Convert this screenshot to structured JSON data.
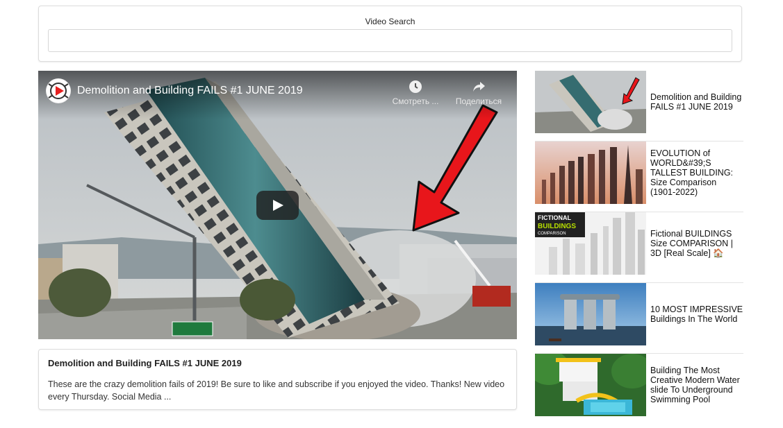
{
  "search": {
    "label": "Video Search",
    "value": "",
    "placeholder": ""
  },
  "player": {
    "title": "Demolition and Building FAILS #1 JUNE 2019",
    "watch_later_label": "Смотреть ...",
    "share_label": "Поделиться",
    "icons": [
      "channel-avatar",
      "clock-icon",
      "share-icon",
      "play-icon"
    ]
  },
  "description": {
    "title": "Demolition and Building FAILS #1 JUNE 2019",
    "text": "These are the crazy demolition fails of 2019! Be sure to like and subscribe if you enjoyed the video. Thanks! New video every Thursday. Social Media ..."
  },
  "related": [
    {
      "title": "Demolition and Building FAILS #1 JUNE 2019"
    },
    {
      "title": "EVOLUTION of WORLD&#39;S TALLEST BUILDING: Size Comparison (1901-2022)"
    },
    {
      "title": "Fictional BUILDINGS Size COMPARISON | 3D [Real Scale] 🏠"
    },
    {
      "title": "10 MOST IMPRESSIVE Buildings In The World"
    },
    {
      "title": "Building The Most Creative Modern Water slide To Underground Swimming Pool"
    }
  ],
  "thumb_text": {
    "fictional_line1": "FICTIONAL",
    "fictional_line2": "BUILDINGS",
    "fictional_line3": "COMPARISON"
  },
  "colors": {
    "border": "#dcdcdc",
    "arrow": "#e8161b",
    "play_button": "#212121"
  }
}
